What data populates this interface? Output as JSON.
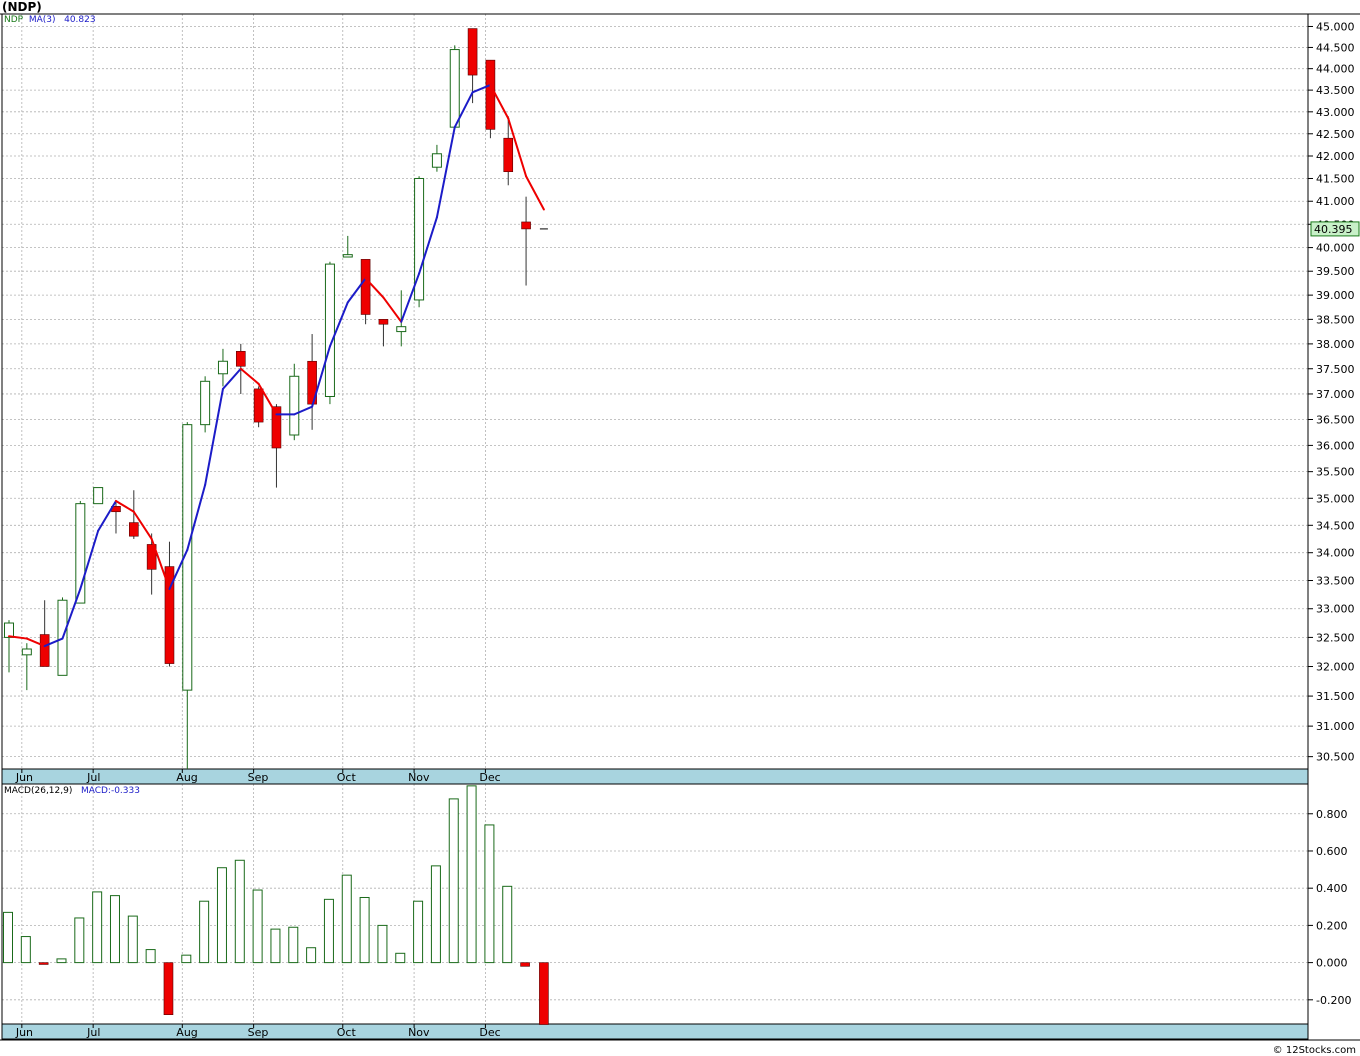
{
  "ticker": "(NDP)",
  "price_panel": {
    "legend_symbol": "NDP",
    "legend_ma_label": "MA(3)",
    "legend_ma_value": "40.823",
    "last_price_label": "40.395"
  },
  "macd_panel": {
    "legend_label": "MACD(26,12,9)",
    "legend_value_label": "MACD:-0.333"
  },
  "copyright": "© 12Stocks.com",
  "colors": {
    "up_candle": "#1a6a1a",
    "down_candle": "#ee0000",
    "ma_rising": "#1c1cc8",
    "ma_falling": "#ee0000",
    "axis_band": "#a8d4df",
    "last_price_bg": "#c8f0c8"
  },
  "chart_data": [
    {
      "type": "candlestick",
      "title": "",
      "x_ticks": [
        "Jun",
        "Jul",
        "Aug",
        "Sep",
        "Oct",
        "Nov",
        "Dec"
      ],
      "x_tick_bar_index": [
        1,
        5,
        10,
        14,
        19,
        23,
        27
      ],
      "y_ticks": [
        30.5,
        31.0,
        31.5,
        32.0,
        32.5,
        33.0,
        33.5,
        34.0,
        34.5,
        35.0,
        35.5,
        36.0,
        36.5,
        37.0,
        37.5,
        38.0,
        38.5,
        39.0,
        39.5,
        40.0,
        40.5,
        41.0,
        41.5,
        42.0,
        42.5,
        43.0,
        43.5,
        44.0,
        44.5,
        45.0
      ],
      "ylim": [
        30.3,
        45.3
      ],
      "log_scale": true,
      "grid": true,
      "candles": [
        {
          "o": 32.5,
          "h": 32.8,
          "l": 31.9,
          "c": 32.75
        },
        {
          "o": 32.2,
          "h": 32.4,
          "l": 31.6,
          "c": 32.3
        },
        {
          "o": 32.55,
          "h": 33.15,
          "l": 32.0,
          "c": 32.0
        },
        {
          "o": 31.85,
          "h": 33.2,
          "l": 31.85,
          "c": 33.15
        },
        {
          "o": 33.1,
          "h": 34.95,
          "l": 33.1,
          "c": 34.9
        },
        {
          "o": 34.9,
          "h": 35.2,
          "l": 34.9,
          "c": 35.2
        },
        {
          "o": 34.85,
          "h": 34.95,
          "l": 34.35,
          "c": 34.75
        },
        {
          "o": 34.55,
          "h": 35.15,
          "l": 34.25,
          "c": 34.3
        },
        {
          "o": 34.15,
          "h": 34.35,
          "l": 33.25,
          "c": 33.7
        },
        {
          "o": 33.75,
          "h": 34.2,
          "l": 32.0,
          "c": 32.05
        },
        {
          "o": 31.6,
          "h": 36.45,
          "l": 30.3,
          "c": 36.4
        },
        {
          "o": 36.4,
          "h": 37.35,
          "l": 36.25,
          "c": 37.25
        },
        {
          "o": 37.4,
          "h": 37.9,
          "l": 37.15,
          "c": 37.65
        },
        {
          "o": 37.85,
          "h": 38.0,
          "l": 37.0,
          "c": 37.55
        },
        {
          "o": 37.1,
          "h": 37.15,
          "l": 36.35,
          "c": 36.45
        },
        {
          "o": 36.75,
          "h": 36.8,
          "l": 35.2,
          "c": 35.95
        },
        {
          "o": 36.2,
          "h": 37.6,
          "l": 36.1,
          "c": 37.35
        },
        {
          "o": 37.65,
          "h": 38.2,
          "l": 36.3,
          "c": 36.8
        },
        {
          "o": 36.95,
          "h": 39.7,
          "l": 36.8,
          "c": 39.65
        },
        {
          "o": 39.8,
          "h": 40.25,
          "l": 39.8,
          "c": 39.85
        },
        {
          "o": 39.75,
          "h": 39.75,
          "l": 38.4,
          "c": 38.6
        },
        {
          "o": 38.5,
          "h": 38.5,
          "l": 37.95,
          "c": 38.4
        },
        {
          "o": 38.25,
          "h": 39.1,
          "l": 37.95,
          "c": 38.35
        },
        {
          "o": 38.9,
          "h": 41.55,
          "l": 38.75,
          "c": 41.5
        },
        {
          "o": 41.75,
          "h": 42.25,
          "l": 41.65,
          "c": 42.05
        },
        {
          "o": 42.65,
          "h": 44.55,
          "l": 42.65,
          "c": 44.45
        },
        {
          "o": 44.95,
          "h": 44.95,
          "l": 43.2,
          "c": 43.85
        },
        {
          "o": 44.2,
          "h": 44.2,
          "l": 42.4,
          "c": 42.6
        },
        {
          "o": 42.4,
          "h": 42.9,
          "l": 41.35,
          "c": 41.65
        },
        {
          "o": 40.55,
          "h": 41.1,
          "l": 39.2,
          "c": 40.4
        }
      ],
      "ma3": {
        "name": "MA(3)",
        "values": [
          32.52,
          32.48,
          32.35,
          32.48,
          33.35,
          34.4,
          34.95,
          34.75,
          34.25,
          33.35,
          34.05,
          35.25,
          37.1,
          37.5,
          37.2,
          36.6,
          36.6,
          36.75,
          37.95,
          38.85,
          39.35,
          38.95,
          38.45,
          39.45,
          40.65,
          42.65,
          43.45,
          43.62,
          42.85,
          41.55,
          40.82
        ]
      }
    },
    {
      "type": "bar",
      "title": "",
      "name": "MACD(26,12,9)",
      "x_ticks": [
        "Jun",
        "Jul",
        "Aug",
        "Sep",
        "Oct",
        "Nov",
        "Dec"
      ],
      "y_ticks": [
        -0.2,
        0.0,
        0.2,
        0.4,
        0.6,
        0.8
      ],
      "ylim": [
        -0.33,
        0.96
      ],
      "grid": true,
      "values": [
        0.27,
        0.14,
        -0.01,
        0.02,
        0.24,
        0.38,
        0.36,
        0.25,
        0.07,
        -0.28,
        0.04,
        0.33,
        0.51,
        0.55,
        0.39,
        0.18,
        0.19,
        0.08,
        0.34,
        0.47,
        0.35,
        0.2,
        0.05,
        0.33,
        0.52,
        0.88,
        0.95,
        0.74,
        0.41,
        -0.02,
        -0.333
      ]
    }
  ]
}
